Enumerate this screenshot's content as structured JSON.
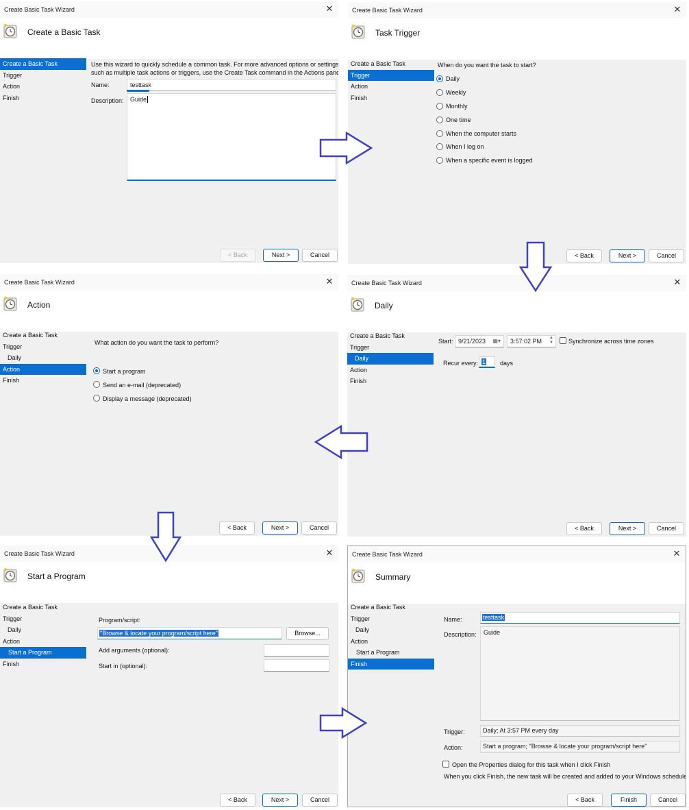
{
  "wizard_title": "Create Basic Task Wizard",
  "close_glyph": "✕",
  "buttons": {
    "back": "< Back",
    "next": "Next >",
    "cancel": "Cancel",
    "finish": "Finish",
    "browse": "Browse..."
  },
  "nav": {
    "create": "Create a Basic Task",
    "trigger": "Trigger",
    "action": "Action",
    "finish": "Finish",
    "daily": "Daily",
    "start_program": "Start a Program"
  },
  "panel1": {
    "heading": "Create a Basic Task",
    "intro_line1": "Use this wizard to quickly schedule a common task.  For more advanced options or settings",
    "intro_line2": "such as multiple task actions or triggers, use the Create Task command in the Actions pane.",
    "name_label": "Name:",
    "name_value": "testtask",
    "desc_label": "Description:",
    "desc_value": "Guide"
  },
  "panel2": {
    "heading": "Task Trigger",
    "question": "When do you want the task to start?",
    "options": [
      "Daily",
      "Weekly",
      "Monthly",
      "One time",
      "When the computer starts",
      "When I log on",
      "When a specific event is logged"
    ],
    "selected": "Daily"
  },
  "panel3": {
    "heading": "Action",
    "question": "What action do you want the task to perform?",
    "options": [
      "Start a program",
      "Send an e-mail (deprecated)",
      "Display a message (deprecated)"
    ],
    "selected": "Start a program"
  },
  "panel4": {
    "heading": "Daily",
    "start_label": "Start:",
    "date": "9/21/2023",
    "time": "3:57:02 PM",
    "sync_label": "Synchronize across time zones",
    "recur_label": "Recur every:",
    "recur_value": "1",
    "days_label": "days"
  },
  "panel5": {
    "heading": "Start a Program",
    "program_label": "Program/script:",
    "program_value": "\"Browse & locate your program/script here\"",
    "args_label": "Add arguments (optional):",
    "startin_label": "Start in (optional):"
  },
  "panel6": {
    "heading": "Summary",
    "name_label": "Name:",
    "name_value": "testtask",
    "desc_label": "Description:",
    "desc_value": "Guide",
    "trigger_label": "Trigger:",
    "trigger_value": "Daily; At 3:57 PM every day",
    "action_label": "Action:",
    "action_value": "Start a program; \"Browse & locate your program/script here\"",
    "open_props_label": "Open the Properties dialog for this task when I click Finish",
    "note": "When you click Finish, the new task will be created and added to your Windows schedule."
  },
  "colors": {
    "selection": "#0a6fd0",
    "arrow": "#3f3fc8",
    "dialog_bg": "#f0f0f0"
  },
  "icons": {
    "task": "clock-icon",
    "close": "close-icon",
    "flow": "block-arrow-icon"
  }
}
